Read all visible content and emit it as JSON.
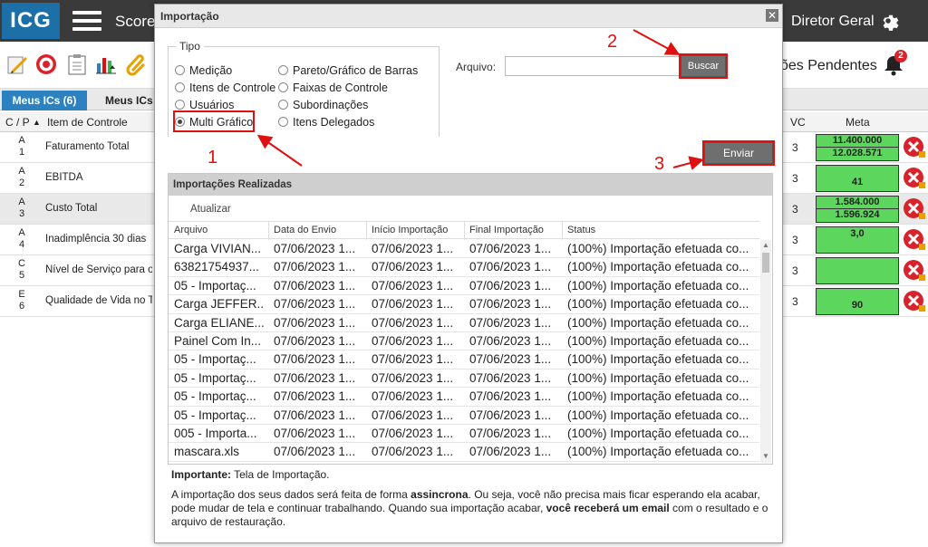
{
  "app": {
    "logo": "ICG",
    "title": "Score",
    "user": "Diretor Geral",
    "pending_label": "ões Pendentes",
    "bell_badge": "2"
  },
  "tabs": [
    "Meus ICs (6)",
    "Meus ICs A"
  ],
  "grid": {
    "headers": {
      "cp": "C / P",
      "item": "Item de Controle",
      "vc": "VC",
      "meta": "Meta"
    },
    "rows": [
      {
        "cp1": "A",
        "cp2": "1",
        "item": "Faturamento Total",
        "vc": "3",
        "m1": "11.400.000",
        "m2": "12.028.571"
      },
      {
        "cp1": "A",
        "cp2": "2",
        "item": "EBITDA",
        "vc": "3",
        "m1": "",
        "m2": "41"
      },
      {
        "cp1": "A",
        "cp2": "3",
        "item": "Custo Total",
        "vc": "3",
        "m1": "1.584.000",
        "m2": "1.596.924"
      },
      {
        "cp1": "A",
        "cp2": "4",
        "item": "Inadimplência 30 dias",
        "vc": "3",
        "m1": "3,0",
        "m2": ""
      },
      {
        "cp1": "C",
        "cp2": "5",
        "item": "Nível de Serviço para o ...",
        "vc": "3",
        "m1": "",
        "m2": ""
      },
      {
        "cp1": "E",
        "cp2": "6",
        "item": "Qualidade de Vida no Tr...",
        "vc": "3",
        "m1": "",
        "m2": "90"
      }
    ]
  },
  "modal": {
    "title": "Importação",
    "close": "✕",
    "tipo_legend": "Tipo",
    "radios": [
      "Medição",
      "Itens de Controle",
      "Usuários",
      "Multi Gráfico",
      "Pareto/Gráfico de Barras",
      "Faixas de Controle",
      "Subordinações",
      "Itens Delegados"
    ],
    "arquivo_label": "Arquivo:",
    "arquivo_value": "",
    "buscar": "Buscar",
    "enviar": "Enviar",
    "annotations": [
      "1",
      "2",
      "3"
    ],
    "imports_title": "Importações Realizadas",
    "refresh": "Atualizar",
    "columns": [
      "Arquivo",
      "Data do Envio",
      "Início Importação",
      "Final Importação",
      "Status"
    ],
    "imports": [
      [
        "Carga VIVIAN...",
        "07/06/2023 1...",
        "07/06/2023 1...",
        "07/06/2023 1...",
        "(100%) Importação efetuada co..."
      ],
      [
        "63821754937...",
        "07/06/2023 1...",
        "07/06/2023 1...",
        "07/06/2023 1...",
        "(100%) Importação efetuada co..."
      ],
      [
        "05 - Importaç...",
        "07/06/2023 1...",
        "07/06/2023 1...",
        "07/06/2023 1...",
        "(100%) Importação efetuada co..."
      ],
      [
        "Carga JEFFER...",
        "07/06/2023 1...",
        "07/06/2023 1...",
        "07/06/2023 1...",
        "(100%) Importação efetuada co..."
      ],
      [
        "Carga ELIANE...",
        "07/06/2023 1...",
        "07/06/2023 1...",
        "07/06/2023 1...",
        "(100%) Importação efetuada co..."
      ],
      [
        "Painel Com In...",
        "07/06/2023 1...",
        "07/06/2023 1...",
        "07/06/2023 1...",
        "(100%) Importação efetuada co..."
      ],
      [
        "05 - Importaç...",
        "07/06/2023 1...",
        "07/06/2023 1...",
        "07/06/2023 1...",
        "(100%) Importação efetuada co..."
      ],
      [
        "05 - Importaç...",
        "07/06/2023 1...",
        "07/06/2023 1...",
        "07/06/2023 1...",
        "(100%) Importação efetuada co..."
      ],
      [
        "05 - Importaç...",
        "07/06/2023 1...",
        "07/06/2023 1...",
        "07/06/2023 1...",
        "(100%) Importação efetuada co..."
      ],
      [
        "05 - Importaç...",
        "07/06/2023 1...",
        "07/06/2023 1...",
        "07/06/2023 1...",
        "(100%) Importação efetuada co..."
      ],
      [
        "005 - Importa...",
        "07/06/2023 1...",
        "07/06/2023 1...",
        "07/06/2023 1...",
        "(100%) Importação efetuada co..."
      ],
      [
        "mascara.xls",
        "07/06/2023 1...",
        "07/06/2023 1...",
        "07/06/2023 1...",
        "(100%) Importação efetuada co..."
      ]
    ],
    "important_label": "Importante:",
    "important_text": " Tela de Importação.",
    "note_part1": "A importação dos seus dados será feita de forma ",
    "note_bold1": "assincrona",
    "note_part2": ". Ou seja, você não precisa mais ficar esperando ela acabar, pode mudar de tela e continuar trabalhando. Quando sua importação acabar, ",
    "note_bold2": "você receberá um email",
    "note_part3": " com o resultado e o arquivo de restauração."
  },
  "colors": {
    "accent_blue": "#2c82c1",
    "topbar": "#3a3a3a",
    "annotation_red": "#e01010",
    "meta_green": "#5cd65c",
    "delete_red": "#d9232b"
  }
}
